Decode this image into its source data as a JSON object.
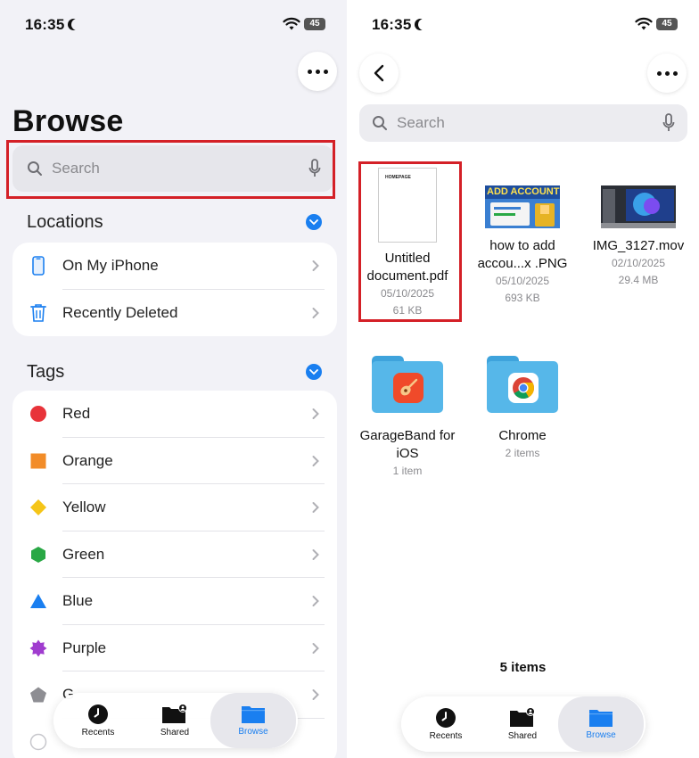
{
  "left": {
    "status": {
      "time": "16:35",
      "battery": "45"
    },
    "title": "Browse",
    "search": {
      "placeholder": "Search"
    },
    "locations": {
      "heading": "Locations",
      "items": [
        {
          "label": "On My iPhone",
          "icon": "iphone-icon"
        },
        {
          "label": "Recently Deleted",
          "icon": "trash-icon"
        }
      ]
    },
    "tags": {
      "heading": "Tags",
      "items": [
        {
          "label": "Red",
          "color": "#e8333a",
          "shape": "circle"
        },
        {
          "label": "Orange",
          "color": "#f28c28",
          "shape": "square"
        },
        {
          "label": "Yellow",
          "color": "#f5c518",
          "shape": "diamond"
        },
        {
          "label": "Green",
          "color": "#29a845",
          "shape": "hexagon"
        },
        {
          "label": "Blue",
          "color": "#1a7ff0",
          "shape": "triangle"
        },
        {
          "label": "Purple",
          "color": "#a03ccf",
          "shape": "star"
        },
        {
          "label": "G",
          "color": "#8e8e93",
          "shape": "pentagon"
        }
      ]
    },
    "tabbar": [
      {
        "label": "Recents",
        "icon": "clock-icon"
      },
      {
        "label": "Shared",
        "icon": "shared-folder-icon"
      },
      {
        "label": "Browse",
        "icon": "folder-icon"
      }
    ]
  },
  "right": {
    "status": {
      "time": "16:35",
      "battery": "45"
    },
    "search": {
      "placeholder": "Search"
    },
    "files": [
      {
        "name_line1": "Untitled",
        "name_line2": "document.pdf",
        "date": "05/10/2025",
        "size": "61 KB",
        "thumb_text": "HOMEPAGE"
      },
      {
        "name_line1": "how to add",
        "name_line2": "accou...x .PNG",
        "date": "05/10/2025",
        "size": "693 KB",
        "thumb_text": "ADD ACCOUNT"
      },
      {
        "name_line1": "IMG_3127.mov",
        "name_line2": "",
        "date": "02/10/2025",
        "size": "29.4 MB"
      }
    ],
    "folders": [
      {
        "name_line1": "GarageBand for",
        "name_line2": "iOS",
        "count": "1 item",
        "icon": "guitar-icon"
      },
      {
        "name_line1": "Chrome",
        "name_line2": "",
        "count": "2 items",
        "icon": "chrome-icon"
      }
    ],
    "item_count": "5 items",
    "tabbar": [
      {
        "label": "Recents",
        "icon": "clock-icon"
      },
      {
        "label": "Shared",
        "icon": "shared-folder-icon"
      },
      {
        "label": "Browse",
        "icon": "folder-icon"
      }
    ]
  },
  "colors": {
    "accent": "#1a7ff0",
    "highlight": "#d42027"
  }
}
